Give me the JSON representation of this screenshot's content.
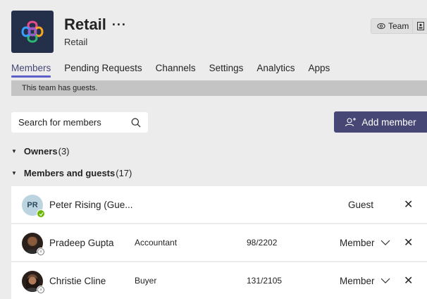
{
  "team": {
    "name": "Retail",
    "more": "···",
    "subtitle": "Retail",
    "team_button_label": "Team"
  },
  "tabs": [
    {
      "label": "Members",
      "active": true
    },
    {
      "label": "Pending Requests"
    },
    {
      "label": "Channels"
    },
    {
      "label": "Settings"
    },
    {
      "label": "Analytics"
    },
    {
      "label": "Apps"
    }
  ],
  "banner": "This team has guests.",
  "search": {
    "placeholder": "Search for members"
  },
  "add_member_label": "Add member",
  "sections": {
    "owners": {
      "label": "Owners",
      "count": "(3)"
    },
    "members": {
      "label": "Members and guests",
      "count": "(17)"
    }
  },
  "members": [
    {
      "initials": "PR",
      "name": "Peter Rising (Gue...",
      "title": "",
      "location": "",
      "role": "Guest",
      "role_editable": false,
      "presence": "available"
    },
    {
      "initials": "",
      "name": "Pradeep Gupta",
      "title": "Accountant",
      "location": "98/2202",
      "role": "Member",
      "role_editable": true,
      "presence": "offline"
    },
    {
      "initials": "",
      "name": "Christie Cline",
      "title": "Buyer",
      "location": "131/2105",
      "role": "Member",
      "role_editable": true,
      "presence": "offline"
    }
  ],
  "colors": {
    "accent": "#464775",
    "tab_underline": "#5b5fc7",
    "banner": "#c4c4c4",
    "background": "#ececec"
  }
}
